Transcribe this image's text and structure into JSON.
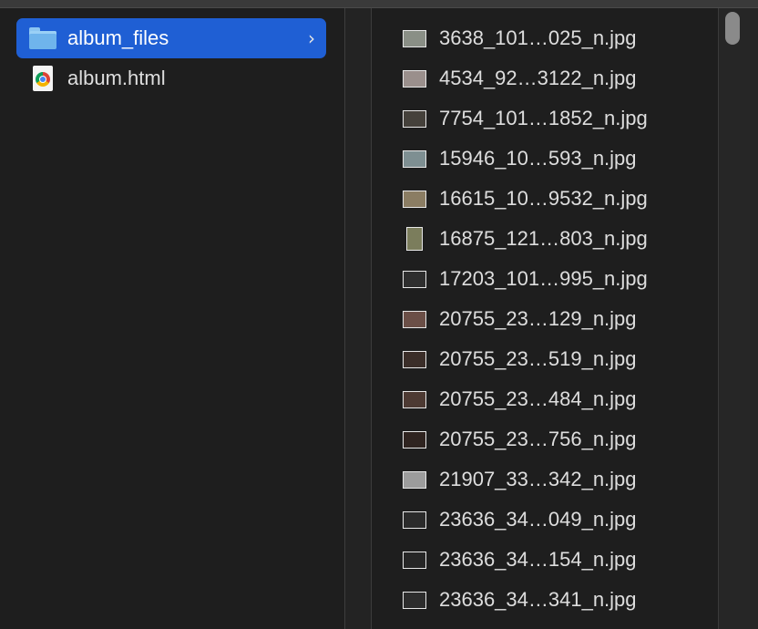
{
  "column1": {
    "items": [
      {
        "label": "album_files",
        "icon": "folder-icon",
        "selected": true
      },
      {
        "label": "album.html",
        "icon": "chrome-html-file-icon",
        "selected": false
      }
    ],
    "chevron": "›"
  },
  "column2": {
    "files": [
      {
        "name": "3638_101…025_n.jpg",
        "thumb_color": "#8a8f86"
      },
      {
        "name": "4534_92…3122_n.jpg",
        "thumb_color": "#9a8f8c"
      },
      {
        "name": "7754_101…1852_n.jpg",
        "thumb_color": "#45413b"
      },
      {
        "name": "15946_10…593_n.jpg",
        "thumb_color": "#7e8f92"
      },
      {
        "name": "16615_10…9532_n.jpg",
        "thumb_color": "#8b7d63"
      },
      {
        "name": "16875_121…803_n.jpg",
        "thumb_color": "#7b7d5c"
      },
      {
        "name": "17203_101…995_n.jpg",
        "thumb_color": "#2e2e2e"
      },
      {
        "name": "20755_23…129_n.jpg",
        "thumb_color": "#6b4f47"
      },
      {
        "name": "20755_23…519_n.jpg",
        "thumb_color": "#3b2e29"
      },
      {
        "name": "20755_23…484_n.jpg",
        "thumb_color": "#4d3a33"
      },
      {
        "name": "20755_23…756_n.jpg",
        "thumb_color": "#2f2420"
      },
      {
        "name": "21907_33…342_n.jpg",
        "thumb_color": "#9c9c9c"
      },
      {
        "name": "23636_34…049_n.jpg",
        "thumb_color": "#2b2b2b"
      },
      {
        "name": "23636_34…154_n.jpg",
        "thumb_color": "#262626"
      },
      {
        "name": "23636_34…341_n.jpg",
        "thumb_color": "#2d2d2d"
      }
    ]
  },
  "colors": {
    "selection": "#1f5fd4",
    "background": "#1e1e1e",
    "text": "#dedede"
  }
}
